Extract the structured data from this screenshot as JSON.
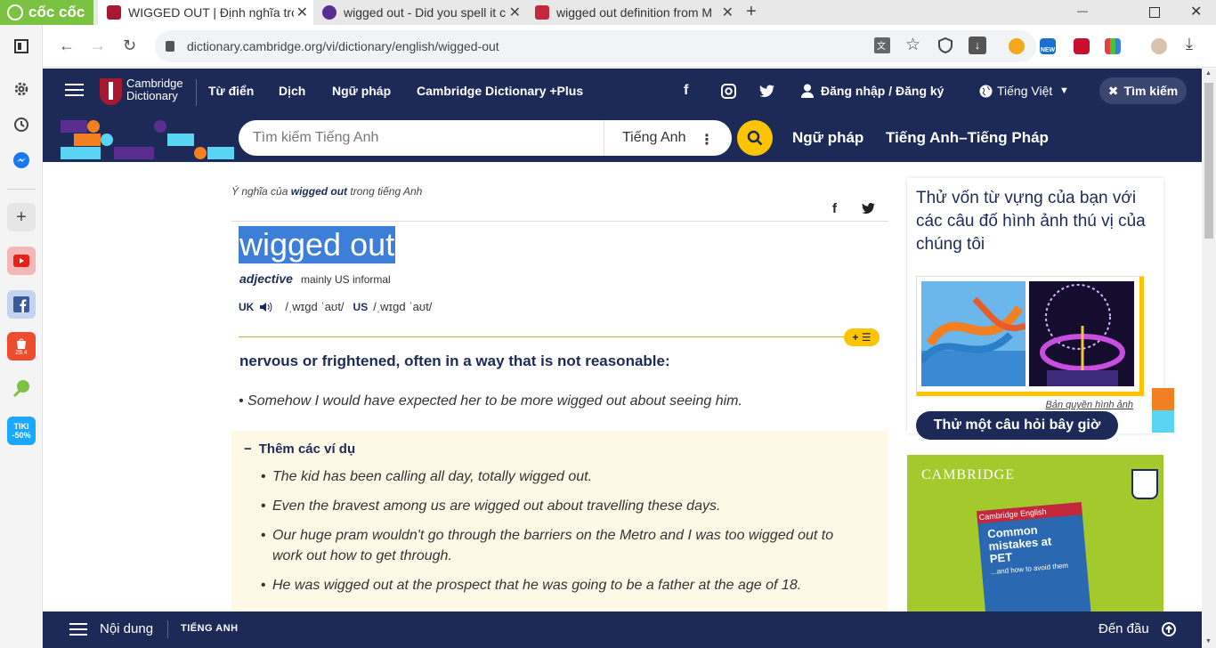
{
  "browser": {
    "logo_label": "cốc cốc",
    "tabs": [
      {
        "title": "WIGGED OUT | Định nghĩa tro",
        "favicon_color": "#a6192e"
      },
      {
        "title": "wigged out - Did you spell it c",
        "favicon_color": "#5a2d91"
      },
      {
        "title": "wigged out definition from M",
        "favicon_color": "#c3283b"
      }
    ],
    "new_tab": "+",
    "url": "dictionary.cambridge.org/vi/dictionary/english/wigged-out",
    "ext_new_label": "NEW"
  },
  "sidebar": {
    "tiki_label": "TIKI -50%",
    "shopee_badge": "28.4"
  },
  "header": {
    "brand_line1": "Cambridge",
    "brand_line2": "Dictionary",
    "nav": [
      "Từ điển",
      "Dịch",
      "Ngữ pháp",
      "Cambridge Dictionary +Plus"
    ],
    "login": "Đăng nhập / Đăng ký",
    "language": "Tiếng Việt",
    "search_toggle": "Tìm kiếm"
  },
  "searchbar": {
    "placeholder": "Tìm kiếm Tiếng Anh",
    "dictionary": "Tiếng Anh",
    "links": [
      "Ngữ pháp",
      "Tiếng Anh–Tiếng Pháp"
    ]
  },
  "entry": {
    "breadcrumb_prefix": "Ý nghĩa của",
    "breadcrumb_word": "wigged out",
    "breadcrumb_suffix": "trong tiếng Anh",
    "headword": "wigged out",
    "pos": "adjective",
    "usage": "mainly US informal",
    "uk_label": "UK",
    "uk_ipa": "/ˌwɪɡd ˈaʊt/",
    "us_label": "US",
    "us_ipa": "/ˌwɪɡd ˈaʊt/",
    "add_list": "+ ☰",
    "definition": "nervous or frightened, often in a way that is not reasonable:",
    "example": "Somehow I would have expected her to be more wigged out about seeing him.",
    "more_title": "Thêm các ví dụ",
    "more_examples": [
      "The kid has been calling all day, totally wigged out.",
      "Even the bravest among us are wigged out about travelling these days.",
      "Our huge pram wouldn't go through the barriers on the Metro and I was too wigged out to work out how to get through.",
      "He was wigged out at the prospect that he was going to be a father at the age of 18."
    ]
  },
  "quiz": {
    "text": "Thử vốn từ vựng của bạn với các câu đố hình ảnh thú vị của chúng tôi",
    "copyright": "Bản quyền hình ảnh",
    "button": "Thử một câu hỏi bây giờ"
  },
  "ad": {
    "brand": "CAMBRIDGE",
    "book_series": "Cambridge English",
    "book_title": "Common mistakes at PET",
    "book_sub": "...and how to avoid them"
  },
  "bottom": {
    "contents": "Nội dung",
    "language": "TIẾNG ANH",
    "top": "Đến đầu"
  }
}
